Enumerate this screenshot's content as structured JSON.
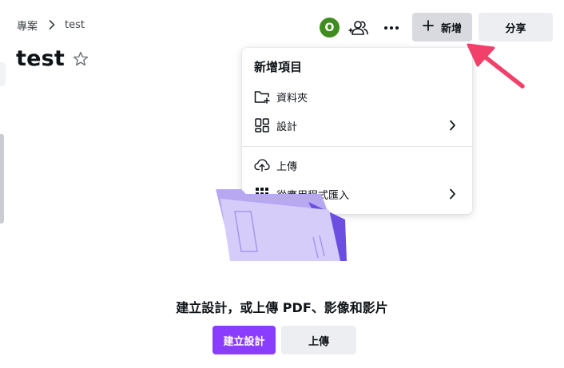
{
  "breadcrumb": {
    "root": "專案",
    "current": "test"
  },
  "page": {
    "title": "test"
  },
  "header": {
    "avatar_initial": "O",
    "new_label": "新增",
    "share_label": "分享"
  },
  "menu": {
    "title": "新增項目",
    "items": [
      {
        "label": "資料夾",
        "icon": "folder-plus-icon",
        "has_submenu": false
      },
      {
        "label": "設計",
        "icon": "grid-layout-icon",
        "has_submenu": true
      },
      {
        "label": "上傳",
        "icon": "cloud-upload-icon",
        "has_submenu": false
      },
      {
        "label": "從應用程式匯入",
        "icon": "apps-grid-icon",
        "has_submenu": true
      }
    ]
  },
  "empty_state": {
    "message": "建立設計，或上傳 PDF、影像和影片",
    "create_label": "建立設計",
    "upload_label": "上傳"
  },
  "colors": {
    "avatar": "#3f8d1e",
    "primary_button": "#8b3dff",
    "annotation_arrow": "#f1416b"
  }
}
